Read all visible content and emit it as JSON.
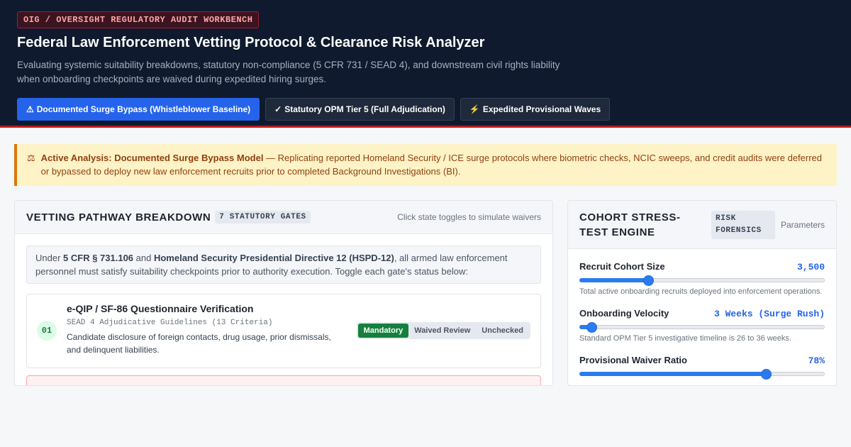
{
  "header": {
    "kicker": "OIG / OVERSIGHT REGULATORY AUDIT WORKBENCH",
    "title": "Federal Law Enforcement Vetting Protocol & Clearance Risk Analyzer",
    "subtitle": "Evaluating systemic suitability breakdowns, statutory non-compliance (5 CFR 731 / SEAD 4), and downstream civil rights liability when onboarding checkpoints are waived during expedited hiring surges.",
    "modes": [
      {
        "icon": "⚠",
        "icon_name": "warning-icon",
        "label": "Documented Surge Bypass (Whistleblower Baseline)",
        "active": true
      },
      {
        "icon": "✓",
        "icon_name": "check-icon",
        "label": "Statutory OPM Tier 5 (Full Adjudication)",
        "active": false
      },
      {
        "icon": "⚡",
        "icon_name": "lightning-icon",
        "label": "Expedited Provisional Waves",
        "active": false
      }
    ]
  },
  "alert": {
    "icon": "⚖",
    "icon_name": "scale-icon",
    "heading": "Active Analysis: Documented Surge Bypass Model",
    "text": " — Replicating reported Homeland Security / ICE surge protocols where biometric checks, NCIC sweeps, and credit audits were deferred or bypassed to deploy new law enforcement recruits prior to completed Background Investigations (BI)."
  },
  "pathway": {
    "title": "VETTING PATHWAY BREAKDOWN",
    "badge": "7 STATUTORY GATES",
    "hint": "Click state toggles to simulate waivers",
    "intro": {
      "pre": "Under ",
      "b1": "5 CFR § 731.106",
      "mid": " and ",
      "b2": "Homeland Security Presidential Directive 12 (HSPD-12)",
      "post": ", all armed law enforcement personnel must satisfy suitability checkpoints prior to authority execution. Toggle each gate's status below:"
    },
    "gates": [
      {
        "number": "01",
        "title": "e-QIP / SF-86 Questionnaire Verification",
        "reference": "SEAD 4 Adjudicative Guidelines (13 Criteria)",
        "description": "Candidate disclosure of foreign contacts, drug usage, prior dismissals, and delinquent liabilities.",
        "options": [
          "Mandatory",
          "Waived Review",
          "Unchecked"
        ],
        "selected": "Mandatory"
      }
    ]
  },
  "engine": {
    "title": "COHORT STRESS-TEST ENGINE",
    "badge": "RISK FORENSICS",
    "hint": "Parameters",
    "params": [
      {
        "label": "Recruit Cohort Size",
        "value": "3,500",
        "level": 0.28,
        "note": "Total active onboarding recruits deployed into enforcement operations."
      },
      {
        "label": "Onboarding Velocity",
        "value": "3 Weeks (Surge Rush)",
        "level": 0.05,
        "note": "Standard OPM Tier 5 investigative timeline is 26 to 36 weeks."
      },
      {
        "label": "Provisional Waiver Ratio",
        "value": "78%",
        "level": 0.76,
        "note": ""
      }
    ]
  },
  "colors": {
    "header_bg": "#0f1a2e",
    "accent_blue": "#2563eb",
    "danger_red": "#b91c1c",
    "alert_bg": "#fef3c7",
    "mandatory_green": "#15803d"
  }
}
